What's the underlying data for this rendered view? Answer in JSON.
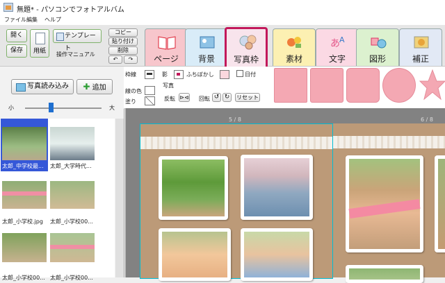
{
  "window": {
    "title": "無題* - パソコンでフォトアルバム"
  },
  "menu": [
    "ファイル",
    "編集",
    "ヘルプ"
  ],
  "toolbar": {
    "open": "開く",
    "save": "保存",
    "paper": "用紙",
    "template": "テンプレート",
    "manual": "操作マニュアル",
    "copy": "コピー",
    "paste": "貼り付け",
    "delete": "削除"
  },
  "tabs": [
    {
      "label": "ページ"
    },
    {
      "label": "背景"
    },
    {
      "label": "写真枠",
      "active": true
    },
    {
      "label": "素材"
    },
    {
      "label": "文字"
    },
    {
      "label": "図形"
    },
    {
      "label": "補正"
    }
  ],
  "left_panel": {
    "load_photos": "写真読み込み",
    "add": "追加",
    "size_small": "小",
    "size_large": "大",
    "thumbnails": [
      "太郎_中学校最...",
      "太郎_大学時代...",
      "太郎_小学校.jpg",
      "太郎_小学校00...",
      "太郎_小学校00...",
      "太郎_小学校00..."
    ]
  },
  "props": {
    "border_label": "枠線",
    "shadow_label": "影",
    "blur_label": "ふちぼかし",
    "date_label": "日付",
    "line_color_label": "線の色",
    "fill_label": "塗り",
    "photo_label": "写真",
    "flip_label": "反転",
    "rotate_label": "回転",
    "reset_label": "リセット"
  },
  "pages": {
    "left_number": "5 / 8",
    "right_number": "6 / 8"
  },
  "colors": {
    "accent_tab_border": "#c2185b",
    "shape_fill": "#f4a8b3",
    "page_bg": "#bc9a78",
    "selection": "#00bcd4"
  }
}
